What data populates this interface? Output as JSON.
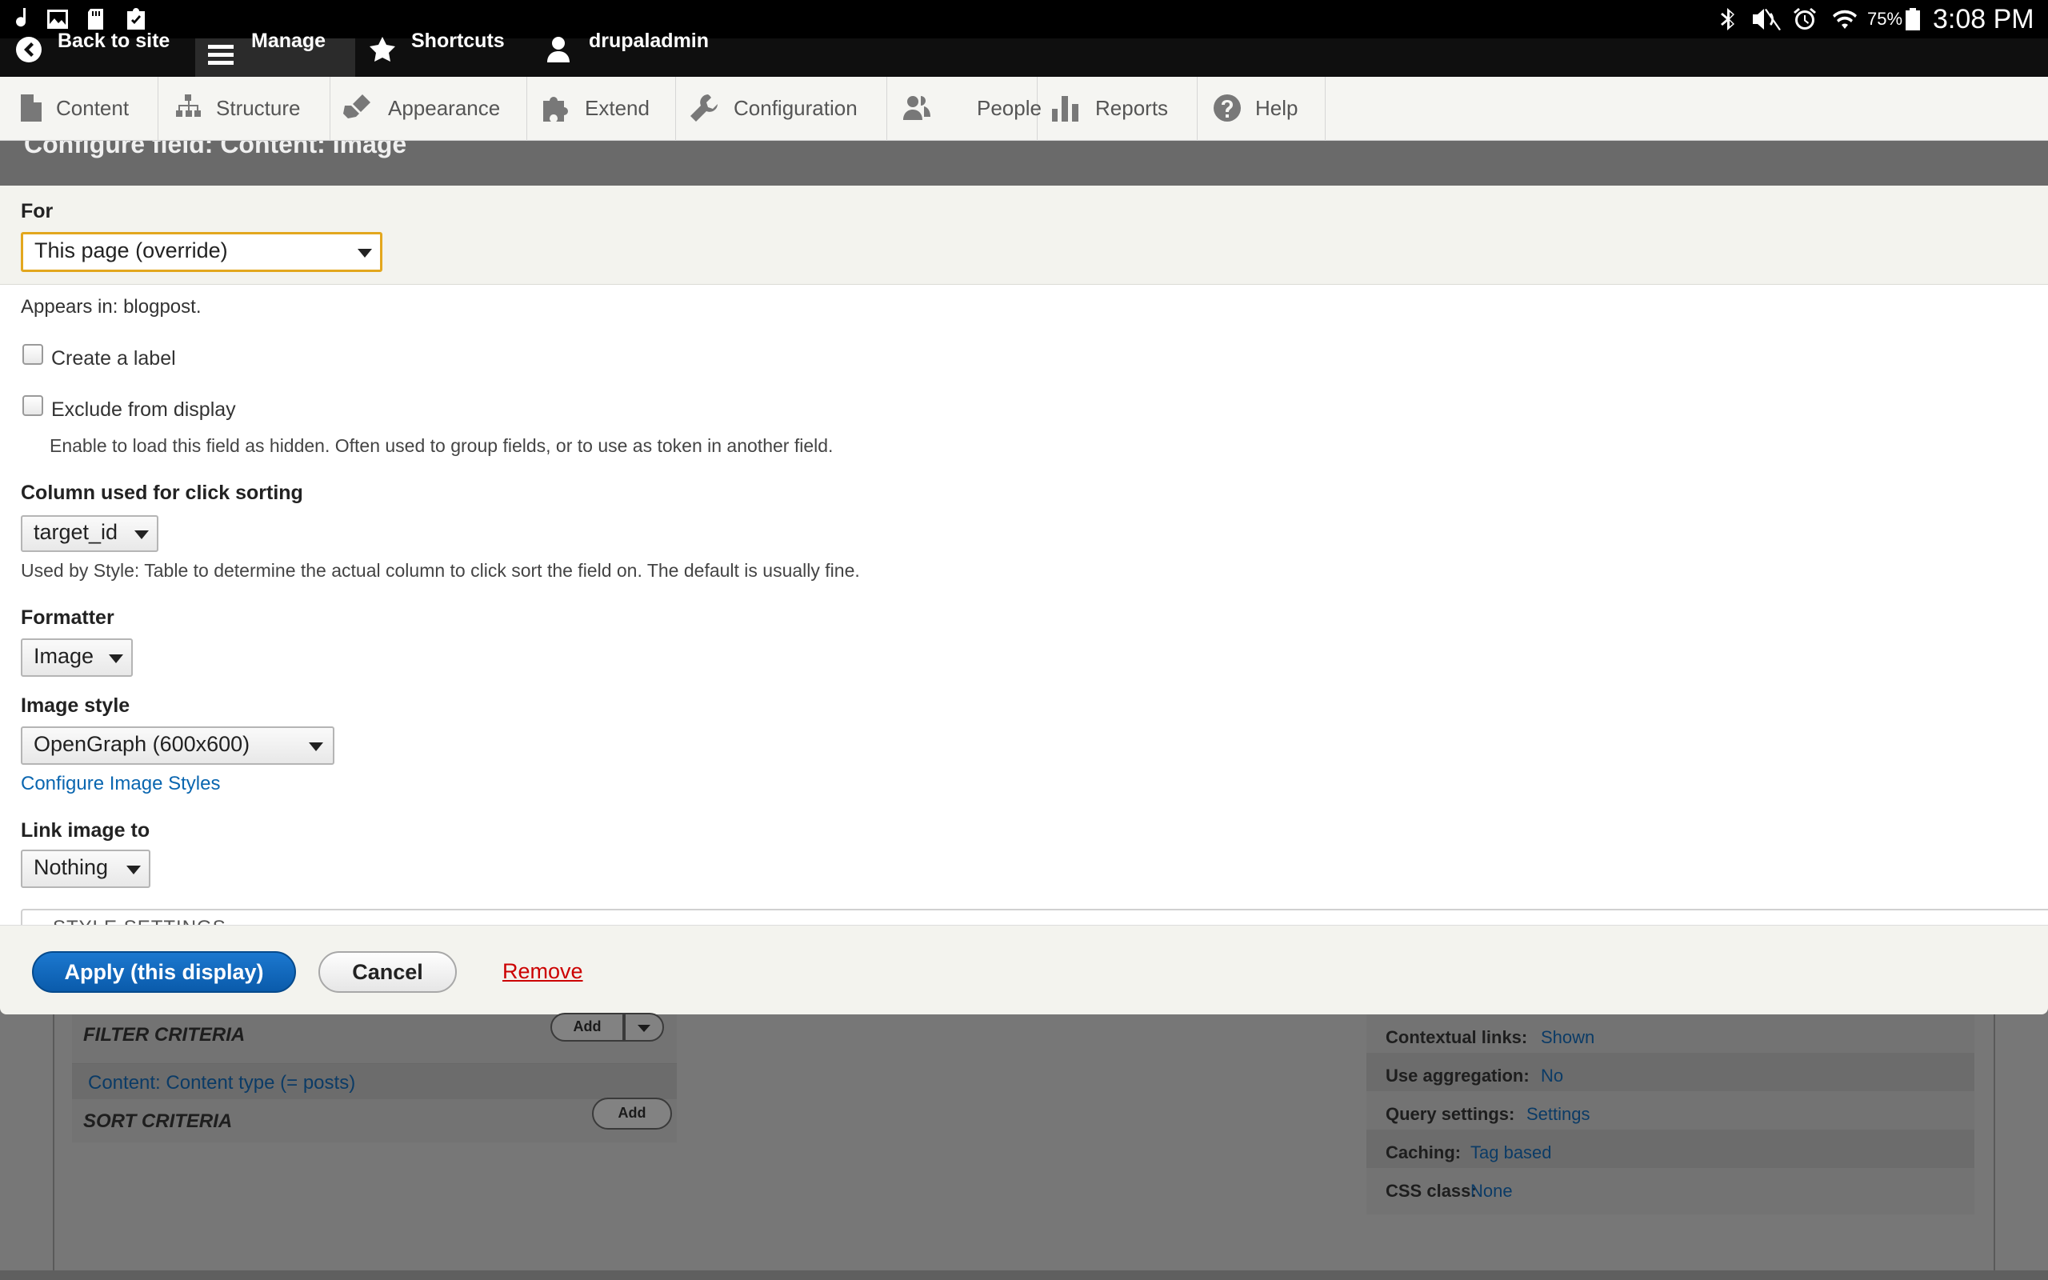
{
  "status_bar": {
    "battery": "75%",
    "time": "3:08 PM",
    "left_icons": [
      "music-note-icon",
      "picture-icon",
      "sd-card-icon",
      "clipboard-check-icon"
    ],
    "right_icons": [
      "bluetooth-icon",
      "mute-icon",
      "alarm-icon",
      "wifi-icon",
      "battery-icon"
    ]
  },
  "toolbar": {
    "back_label": "Back to site",
    "manage_label": "Manage",
    "shortcuts_label": "Shortcuts",
    "user_label": "drupaladmin"
  },
  "admin_menu": {
    "items": [
      {
        "label": "Content",
        "icon": "page-icon"
      },
      {
        "label": "Structure",
        "icon": "sitemap-icon"
      },
      {
        "label": "Appearance",
        "icon": "brush-icon"
      },
      {
        "label": "Extend",
        "icon": "puzzle-icon"
      },
      {
        "label": "Configuration",
        "icon": "wrench-icon"
      },
      {
        "label": "People",
        "icon": "people-icon"
      },
      {
        "label": "Reports",
        "icon": "bar-chart-icon"
      },
      {
        "label": "Help",
        "icon": "help-icon"
      }
    ]
  },
  "dialog": {
    "title": "Configure field: Content: Image",
    "for_label": "For",
    "for_value": "This page (override)",
    "appears_in": "Appears in: blogpost.",
    "create_label": "Create a label",
    "exclude_label": "Exclude from display",
    "exclude_desc": "Enable to load this field as hidden. Often used to group fields, or to use as token in another field.",
    "click_sort_label": "Column used for click sorting",
    "click_sort_value": "target_id",
    "click_sort_desc": "Used by Style: Table to determine the actual column to click sort the field on. The default is usually fine.",
    "formatter_label": "Formatter",
    "formatter_value": "Image",
    "image_style_label": "Image style",
    "image_style_value": "OpenGraph (600x600)",
    "configure_link": "Configure Image Styles",
    "link_image_label": "Link image to",
    "link_image_value": "Nothing",
    "style_settings": "STYLE SETTINGS",
    "apply_button": "Apply (this display)",
    "cancel_button": "Cancel",
    "remove_link": "Remove"
  },
  "background": {
    "filter_title": "FILTER CRITERIA",
    "filter_add": "Add",
    "filter_item": "Content: Content type (= posts)",
    "sort_title": "SORT CRITERIA",
    "sort_add": "Add",
    "settings": [
      {
        "label": "Contextual links:",
        "value": "Shown"
      },
      {
        "label": "Use aggregation:",
        "value": "No"
      },
      {
        "label": "Query settings:",
        "value": "Settings"
      },
      {
        "label": "Caching:",
        "value": "Tag based"
      },
      {
        "label": "CSS class:",
        "value": "None"
      }
    ]
  }
}
